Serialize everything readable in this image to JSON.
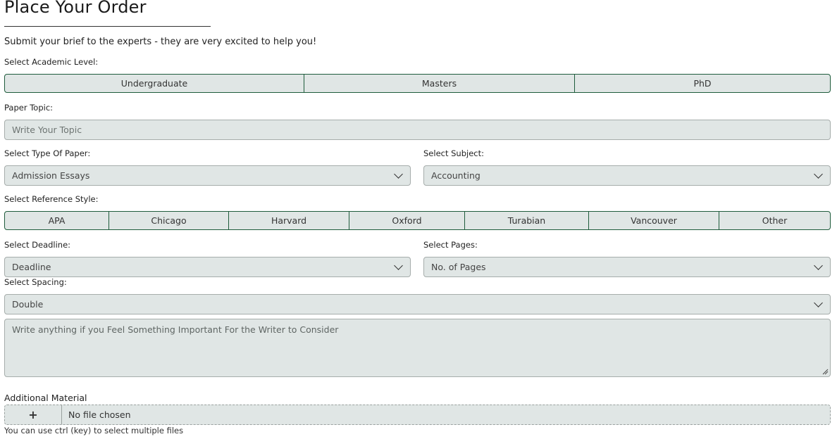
{
  "header": {
    "title": "Place Your Order",
    "subtitle": "Submit your brief to the experts - they are very excited to help you!"
  },
  "academic_level": {
    "label": "Select Academic Level:",
    "options": [
      "Undergraduate",
      "Masters",
      "PhD"
    ]
  },
  "paper_topic": {
    "label": "Paper Topic:",
    "placeholder": "Write Your Topic"
  },
  "paper_type": {
    "label": "Select Type Of Paper:",
    "value": "Admission Essays"
  },
  "subject": {
    "label": "Select Subject:",
    "value": "Accounting"
  },
  "reference_style": {
    "label": "Select Reference Style:",
    "options": [
      "APA",
      "Chicago",
      "Harvard",
      "Oxford",
      "Turabian",
      "Vancouver",
      "Other"
    ]
  },
  "deadline": {
    "label": "Select Deadline:",
    "value": "Deadline"
  },
  "pages": {
    "label": "Select Pages:",
    "value": "No. of Pages"
  },
  "spacing": {
    "label": "Select Spacing:",
    "value": "Double"
  },
  "notes": {
    "placeholder": "Write anything if you Feel Something Important For the Writer to Consider"
  },
  "attachment": {
    "label": "Additional Material",
    "button": "+",
    "status": "No file chosen",
    "hint": "You can use ctrl (key) to select multiple files"
  },
  "colors": {
    "field_bg": "#e0e6e5",
    "accent_border": "#1f5c3c"
  }
}
